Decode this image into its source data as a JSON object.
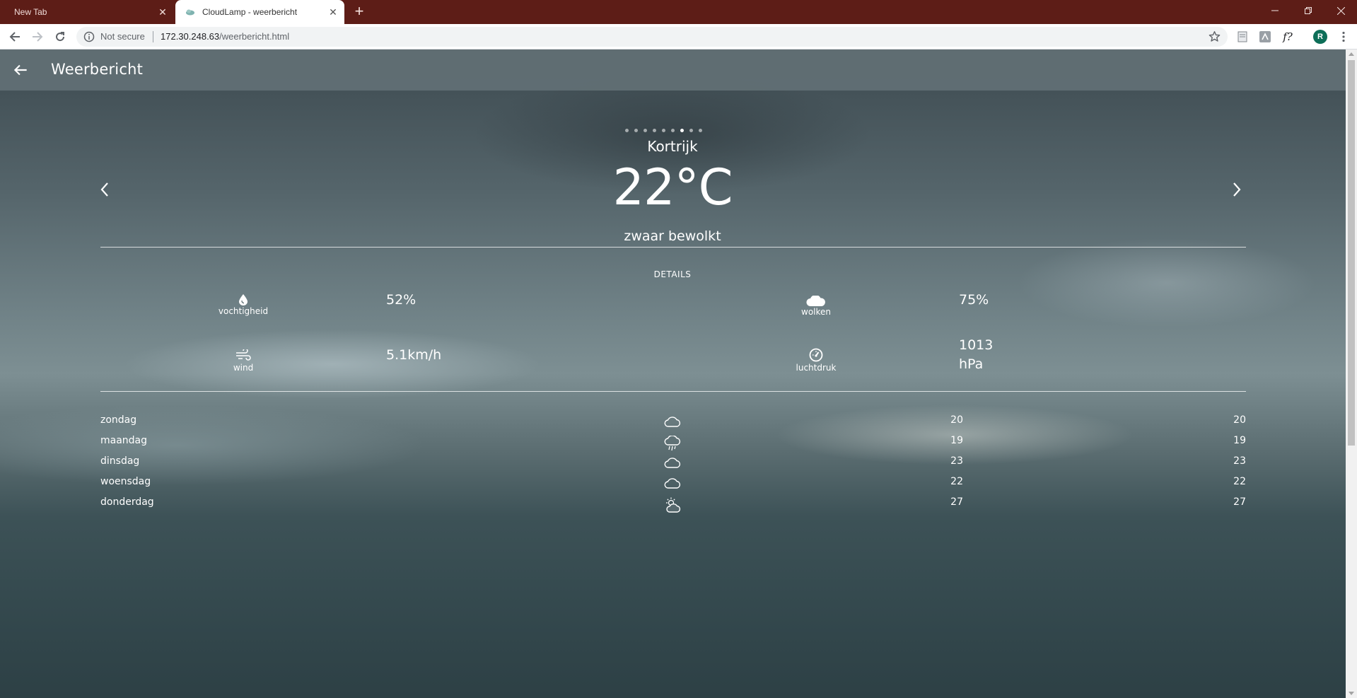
{
  "browser": {
    "tabs": [
      {
        "title": "New Tab",
        "active": false
      },
      {
        "title": "CloudLamp - weerbericht",
        "active": true
      }
    ],
    "security_label": "Not secure",
    "url_host": "172.30.248.63",
    "url_path": "/weerbericht.html",
    "avatar_initial": "R",
    "extension_icons": [
      "document-icon",
      "translate-icon",
      "formula-icon"
    ]
  },
  "app": {
    "title": "Weerbericht"
  },
  "carousel": {
    "slide_count": 9,
    "active_index": 6
  },
  "current": {
    "city": "Kortrijk",
    "temperature": "22°C",
    "description": "zwaar bewolkt"
  },
  "details": {
    "heading": "DETAILS",
    "humidity_label": "vochtigheid",
    "humidity_value": "52%",
    "clouds_label": "wolken",
    "clouds_value": "75%",
    "wind_label": "wind",
    "wind_value": "5.1km/h",
    "pressure_label": "luchtdruk",
    "pressure_value": "1013",
    "pressure_unit": "hPa"
  },
  "forecast": [
    {
      "day": "zondag",
      "icon": "cloud-icon",
      "min": "20",
      "max": "20"
    },
    {
      "day": "maandag",
      "icon": "rain-cloud-icon",
      "min": "19",
      "max": "19"
    },
    {
      "day": "dinsdag",
      "icon": "cloud-icon",
      "min": "23",
      "max": "23"
    },
    {
      "day": "woensdag",
      "icon": "cloud-icon",
      "min": "22",
      "max": "22"
    },
    {
      "day": "donderdag",
      "icon": "sun-behind-cloud-icon",
      "min": "27",
      "max": "27"
    }
  ]
}
